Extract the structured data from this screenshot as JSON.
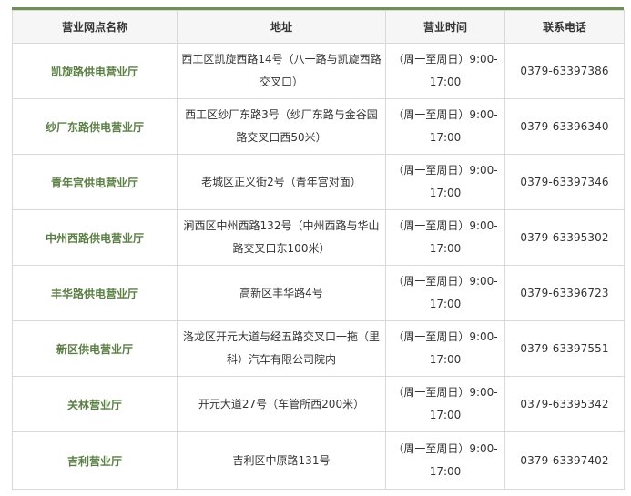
{
  "table": {
    "headers": [
      "营业网点名称",
      "地址",
      "营业时间",
      "联系电话"
    ],
    "rows": [
      {
        "name": "凯旋路供电营业厅",
        "address": "西工区凯旋西路14号（八一路与凯旋西路交叉口）",
        "hours": "（周一至周日）9:00-17:00",
        "phone": "0379-63397386"
      },
      {
        "name": "纱厂东路供电营业厅",
        "address": "西工区纱厂东路3号（纱厂东路与金谷园路交叉口西50米）",
        "hours": "（周一至周日）9:00-17:00",
        "phone": "0379-63396340"
      },
      {
        "name": "青年宫供电营业厅",
        "address": "老城区正义街2号（青年宫对面）",
        "hours": "（周一至周日）9:00-17:00",
        "phone": "0379-63397346"
      },
      {
        "name": "中州西路供电营业厅",
        "address": "涧西区中州西路132号（中州西路与华山路交叉口东100米）",
        "hours": "（周一至周日）9:00-17:00",
        "phone": "0379-63395302"
      },
      {
        "name": "丰华路供电营业厅",
        "address": "高新区丰华路4号",
        "hours": "（周一至周日）9:00-17:00",
        "phone": "0379-63396723"
      },
      {
        "name": "新区供电营业厅",
        "address": "洛龙区开元大道与经五路交叉口一拖（里科）汽车有限公司院内",
        "hours": "（周一至周日）9:00-17:00",
        "phone": "0379-63397551"
      },
      {
        "name": "关林营业厅",
        "address": "开元大道27号（车管所西200米）",
        "hours": "（周一至周日）9:00-17:00",
        "phone": "0379-63395342"
      },
      {
        "name": "吉利营业厅",
        "address": "吉利区中原路131号",
        "hours": "（周一至周日）9:00-17:00",
        "phone": "0379-63397402"
      }
    ]
  }
}
